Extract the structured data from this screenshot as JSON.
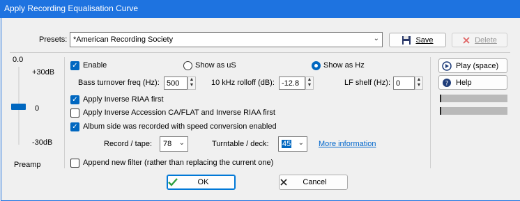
{
  "window": {
    "title": "Apply Recording Equalisation Curve"
  },
  "presets": {
    "label": "Presets:",
    "value": "*American Recording Society",
    "save_label": "Save",
    "delete_label": "Delete"
  },
  "preamp": {
    "value": "0.0",
    "max_label": "+30dB",
    "mid_label": "0",
    "min_label": "-30dB",
    "caption": "Preamp",
    "level_db": 0
  },
  "options": {
    "enable": {
      "label": "Enable",
      "checked": true
    },
    "show_us": {
      "label": "Show as uS",
      "selected": false
    },
    "show_hz": {
      "label": "Show as Hz",
      "selected": true
    },
    "bass": {
      "label": "Bass turnover freq (Hz):",
      "value": "500"
    },
    "rolloff": {
      "label": "10 kHz rolloff (dB):",
      "value": "-12.8"
    },
    "lfshelf": {
      "label": "LF shelf (Hz):",
      "value": "0"
    },
    "riaa": {
      "label": "Apply Inverse RIAA first",
      "checked": true
    },
    "accession": {
      "label": "Apply Inverse Accession CA/FLAT and Inverse RIAA first",
      "checked": false
    },
    "speedconv": {
      "label": "Album side was recorded with speed conversion enabled",
      "checked": true
    },
    "record_tape": {
      "label": "Record / tape:",
      "value": "78"
    },
    "turntable": {
      "label": "Turntable / deck:",
      "value": "45"
    },
    "more_info": "More information",
    "append": {
      "label": "Append new filter (rather than replacing the current one)",
      "checked": false
    }
  },
  "side": {
    "play_label": "Play (space)",
    "help_label": "Help"
  },
  "footer": {
    "ok_label": "OK",
    "cancel_label": "Cancel"
  },
  "colors": {
    "titlebar": "#1e73e0",
    "accent": "#0067c0",
    "link": "#0066cc"
  }
}
